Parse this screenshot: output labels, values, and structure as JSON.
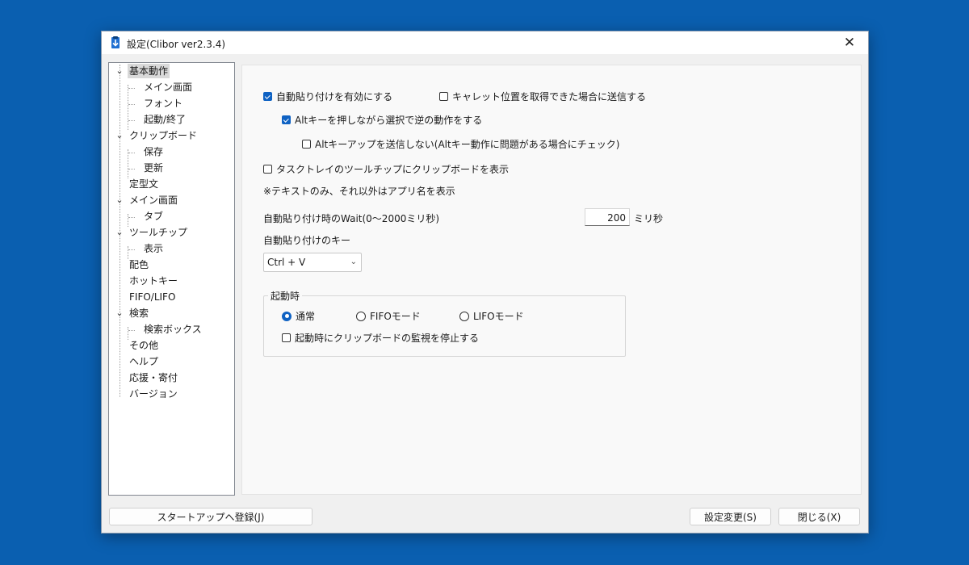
{
  "window": {
    "title": "設定(Clibor ver2.3.4)",
    "close_glyph": "✕"
  },
  "tree": {
    "items": [
      {
        "label": "基本動作",
        "selected": true
      },
      {
        "label": "メイン画面"
      },
      {
        "label": "フォント"
      },
      {
        "label": "起動/終了"
      },
      {
        "label": "クリップボード"
      },
      {
        "label": "保存"
      },
      {
        "label": "更新"
      },
      {
        "label": "定型文"
      },
      {
        "label": "メイン画面"
      },
      {
        "label": "タブ"
      },
      {
        "label": "ツールチップ"
      },
      {
        "label": "表示"
      },
      {
        "label": "配色"
      },
      {
        "label": "ホットキー"
      },
      {
        "label": "FIFO/LIFO"
      },
      {
        "label": "検索"
      },
      {
        "label": "検索ボックス"
      },
      {
        "label": "その他"
      },
      {
        "label": "ヘルプ"
      },
      {
        "label": "応援・寄付"
      },
      {
        "label": "バージョン"
      }
    ]
  },
  "options": {
    "auto_paste": {
      "label": "自動貼り付けを有効にする",
      "checked": true
    },
    "caret_send": {
      "label": "キャレット位置を取得できた場合に送信する",
      "checked": false
    },
    "alt_reverse": {
      "label": "Altキーを押しながら選択で逆の動作をする",
      "checked": true
    },
    "alt_up": {
      "label": "Altキーアップを送信しない(Altキー動作に問題がある場合にチェック)",
      "checked": false
    },
    "tray_tooltip": {
      "label": "タスクトレイのツールチップにクリップボードを表示",
      "checked": false
    },
    "tray_note": "※テキストのみ、それ以外はアプリ名を表示",
    "wait_label": "自動貼り付け時のWait(0～2000ミリ秒)",
    "wait_value": "200",
    "wait_unit": "ミリ秒",
    "key_label": "自動貼り付けのキー",
    "key_value": "Ctrl + V"
  },
  "startup_group": {
    "title": "起動時",
    "modes": [
      {
        "label": "通常",
        "checked": true
      },
      {
        "label": "FIFOモード",
        "checked": false
      },
      {
        "label": "LIFOモード",
        "checked": false
      }
    ],
    "stop_monitor": {
      "label": "起動時にクリップボードの監視を停止する",
      "checked": false
    }
  },
  "footer": {
    "startup_button": "スタートアップへ登録(J)",
    "apply_button": "設定変更(S)",
    "close_button": "閉じる(X)"
  },
  "colors": {
    "accent": "#0f62c3",
    "desktop": "#0a5fb0"
  }
}
